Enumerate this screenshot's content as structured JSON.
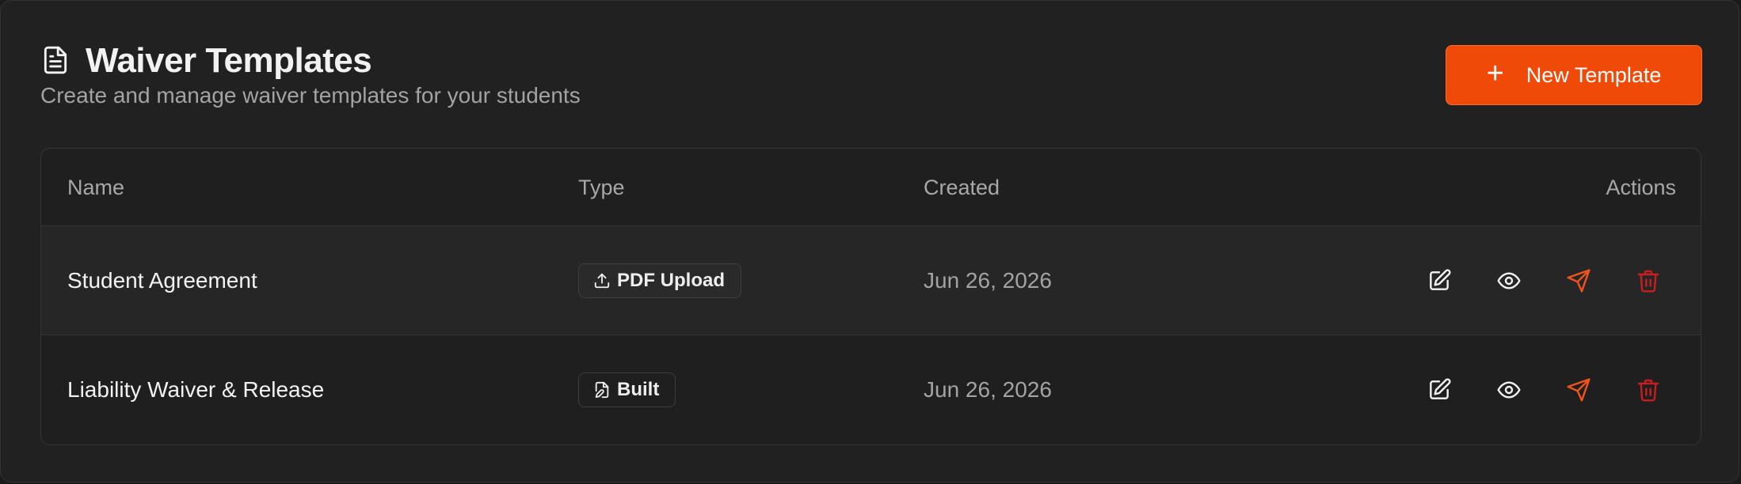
{
  "header": {
    "title": "Waiver Templates",
    "subtitle": "Create and manage waiver templates for your students",
    "icon": "document-icon",
    "new_button": {
      "icon": "plus-icon",
      "label": "New Template"
    }
  },
  "colors": {
    "accent": "#f04a09",
    "send_icon": "#f0531c",
    "delete_icon": "#c81e1e",
    "background": "#212121"
  },
  "table": {
    "columns": [
      "Name",
      "Type",
      "Created",
      "Actions"
    ],
    "rows": [
      {
        "name": "Student Agreement",
        "type": "PDF Upload",
        "type_icon": "upload-icon",
        "created": "Jun 26, 2026",
        "actions": [
          "edit-icon",
          "eye-icon",
          "send-icon",
          "trash-icon"
        ]
      },
      {
        "name": "Liability Waiver & Release",
        "type": "Built",
        "type_icon": "file-edit-icon",
        "created": "Jun 26, 2026",
        "actions": [
          "edit-icon",
          "eye-icon",
          "send-icon",
          "trash-icon"
        ]
      }
    ]
  }
}
